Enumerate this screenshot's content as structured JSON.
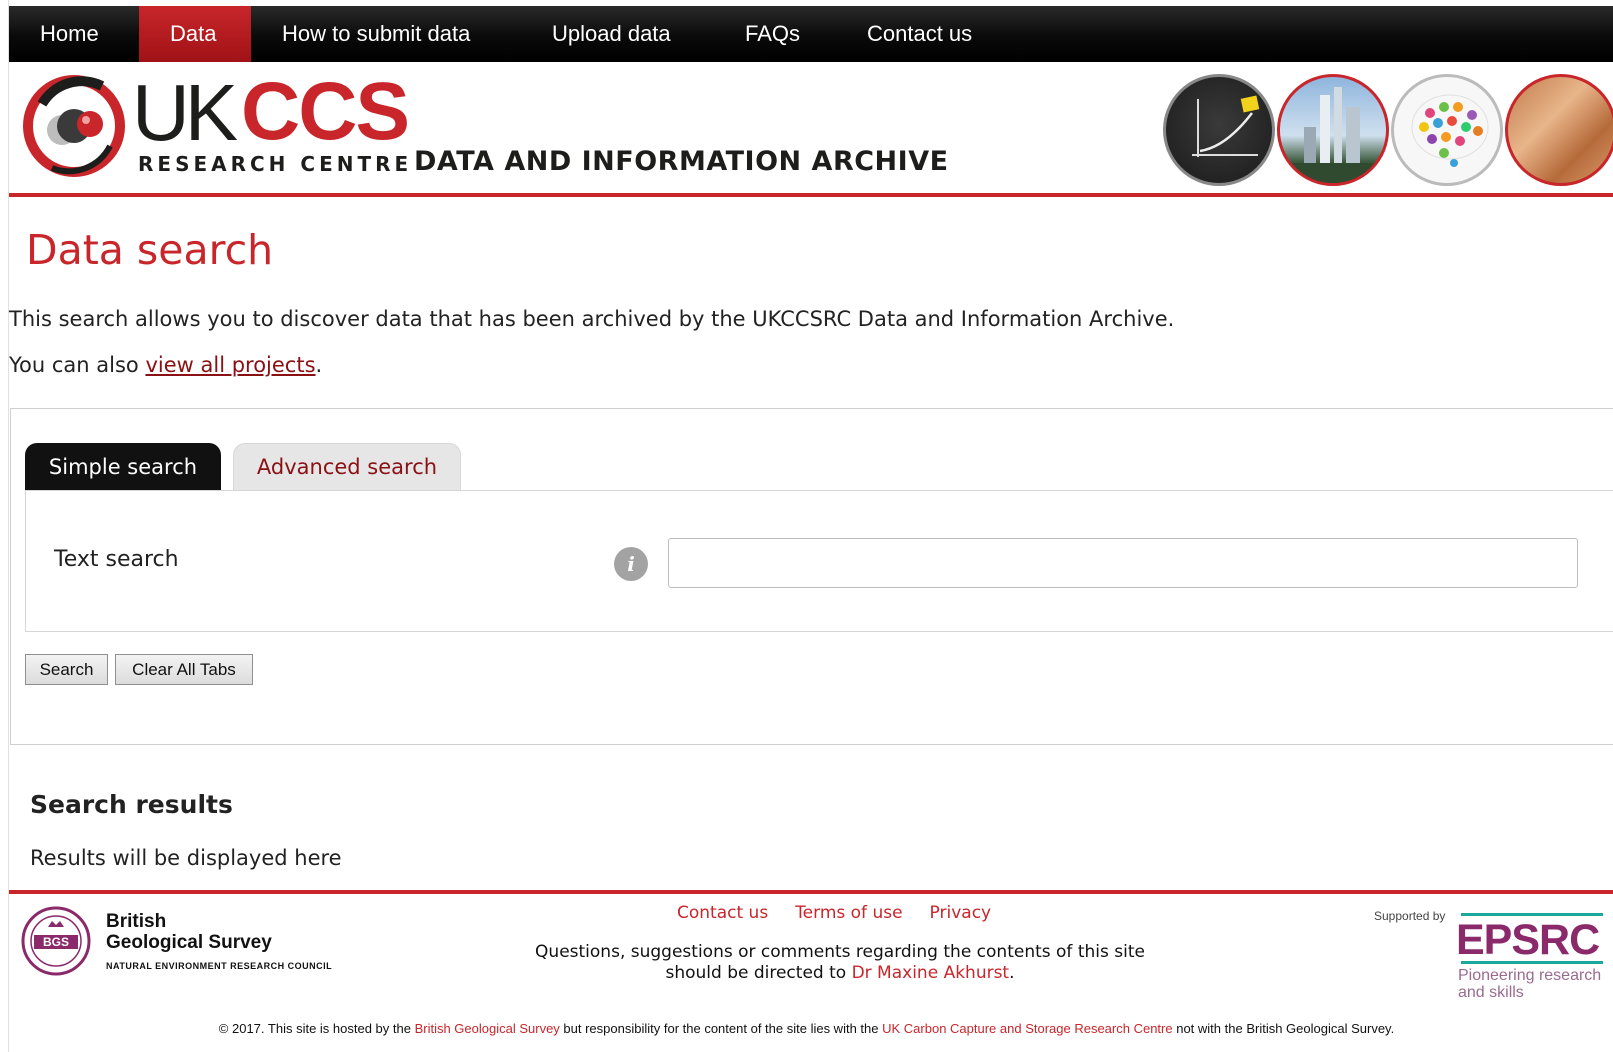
{
  "nav": {
    "items": [
      {
        "label": "Home",
        "active": false
      },
      {
        "label": "Data",
        "active": true
      },
      {
        "label": "How to submit data",
        "active": false
      },
      {
        "label": "Upload data",
        "active": false
      },
      {
        "label": "FAQs",
        "active": false
      },
      {
        "label": "Contact us",
        "active": false
      }
    ]
  },
  "banner": {
    "logo_uk": "UK",
    "logo_ccs": "CCS",
    "logo_subtitle": "RESEARCH CENTRE",
    "archive_title": "DATA AND INFORMATION ARCHIVE",
    "accent_color": "#c8262b"
  },
  "page": {
    "title": "Data search",
    "intro": "This search allows you to discover data that has been archived by the UKCCSRC Data and Information Archive.",
    "intro2_prefix": "You can also ",
    "intro2_link": "view all projects",
    "intro2_suffix": "."
  },
  "search": {
    "tabs": [
      {
        "label": "Simple search",
        "active": true
      },
      {
        "label": "Advanced search",
        "active": false
      }
    ],
    "text_search_label": "Text search",
    "text_search_value": "",
    "info_icon": "info-icon",
    "search_button": "Search",
    "clear_button": "Clear All Tabs"
  },
  "results": {
    "heading": "Search results",
    "placeholder": "Results will be displayed here"
  },
  "footer": {
    "bgs_name_line1": "British",
    "bgs_name_line2": "Geological Survey",
    "bgs_subtitle": "NATURAL ENVIRONMENT RESEARCH COUNCIL",
    "links": [
      "Contact us",
      "Terms of use",
      "Privacy"
    ],
    "question_line1": "Questions, suggestions or comments regarding the contents of this site",
    "question_line2_prefix": "should be directed to ",
    "question_line2_link": "Dr Maxine Akhurst",
    "question_line2_suffix": ".",
    "supported_by": "Supported by",
    "epsrc_logo": "EPSRC",
    "epsrc_tagline": "Pioneering research and skills",
    "copyright_prefix": "© 2017. This site is hosted by the ",
    "copyright_link1": "British Geological Survey",
    "copyright_mid": " but responsibility for the content of the site lies with the ",
    "copyright_link2": "UK Carbon Capture and Storage Research Centre",
    "copyright_suffix": " not with the British Geological Survey."
  }
}
